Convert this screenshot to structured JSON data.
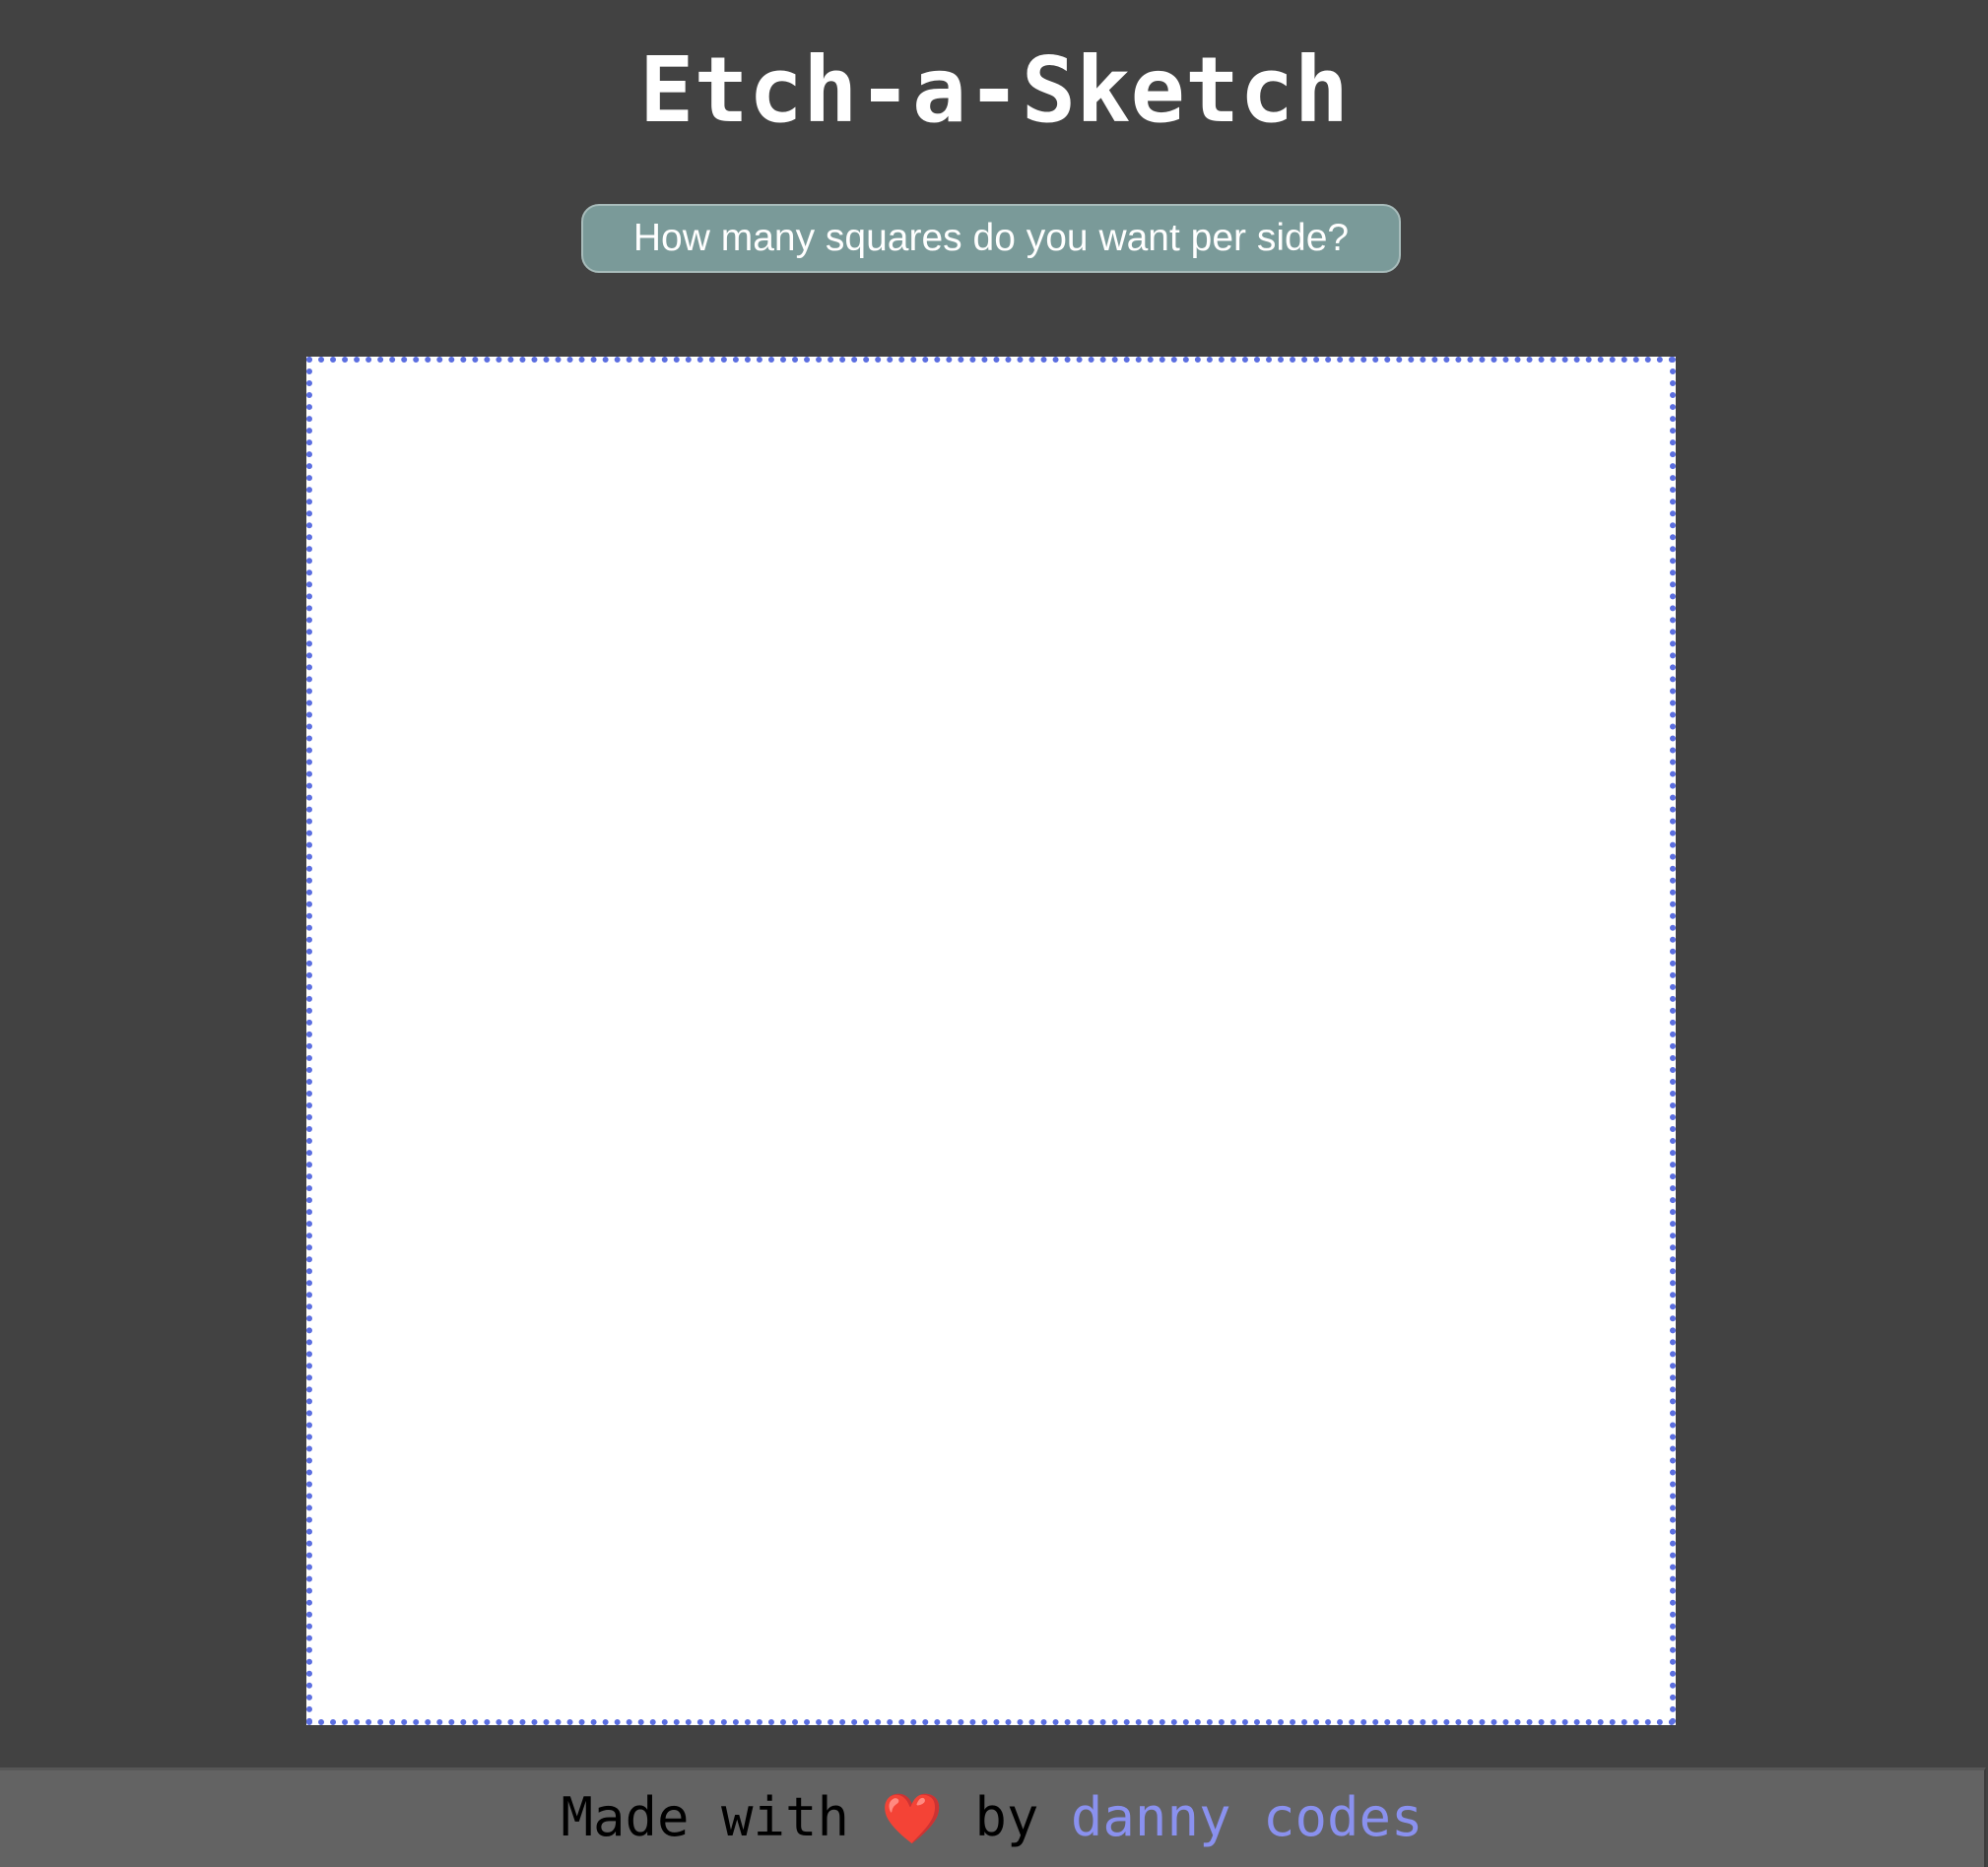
{
  "header": {
    "title": "Etch-a-Sketch"
  },
  "controls": {
    "grid_size_button_label": "How many squares do you want per side?"
  },
  "sketch_grid": {
    "background": "#ffffff",
    "border_color": "#5b6ee0"
  },
  "footer": {
    "made_with": "Made with",
    "heart_icon": "heart-icon",
    "by": "by",
    "author_link": "danny codes",
    "link_color": "#8a91ef"
  },
  "colors": {
    "page_background": "#424242",
    "button_background": "#7a9a99",
    "footer_background": "#636363"
  }
}
